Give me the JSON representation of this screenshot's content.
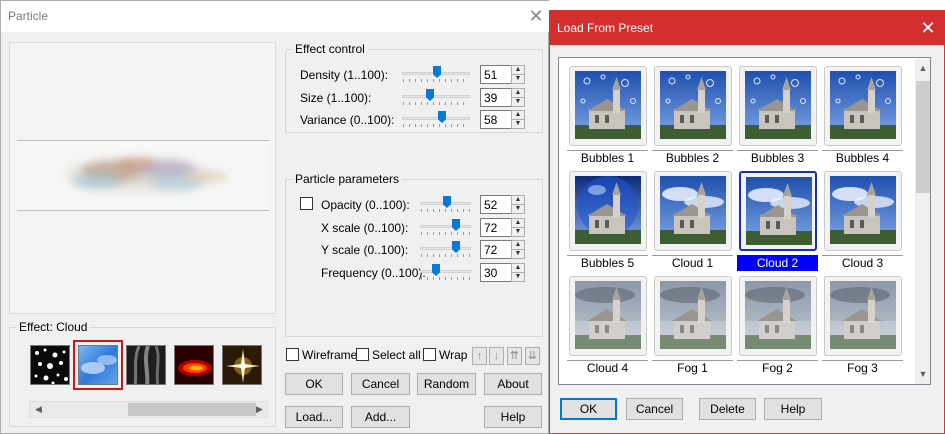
{
  "particle_dialog": {
    "title": "Particle",
    "close_glyph": "✕",
    "effect_group": {
      "label": "Effect: Cloud",
      "thumbnails": [
        {
          "name": "effect-stars",
          "selected": false
        },
        {
          "name": "effect-cloud",
          "selected": true
        },
        {
          "name": "effect-smoke",
          "selected": false
        },
        {
          "name": "effect-fire",
          "selected": false
        },
        {
          "name": "effect-sparkle",
          "selected": false
        }
      ],
      "scroll_left": "◀",
      "scroll_right": "▶"
    },
    "effect_control": {
      "label": "Effect control",
      "density": {
        "label": "Density (1..100):",
        "value": "51"
      },
      "size": {
        "label": "Size (1..100):",
        "value": "39"
      },
      "variance": {
        "label": "Variance (0..100):",
        "value": "58"
      }
    },
    "particle_parameters": {
      "label": "Particle parameters",
      "opacity": {
        "label": "Opacity (0..100):",
        "value": "52",
        "checked": false
      },
      "x_scale": {
        "label": "X scale (0..100):",
        "value": "72"
      },
      "y_scale": {
        "label": "Y scale (0..100):",
        "value": "72"
      },
      "frequency": {
        "label": "Frequency (0..100):",
        "value": "30"
      }
    },
    "options": {
      "wireframe": "Wireframe",
      "select_all": "Select all",
      "wrap": "Wrap"
    },
    "arrow_buttons": [
      "↑",
      "↓",
      "⇈",
      "⇊"
    ],
    "buttons": {
      "ok": "OK",
      "cancel": "Cancel",
      "random": "Random",
      "about": "About",
      "load": "Load...",
      "add": "Add...",
      "help": "Help"
    }
  },
  "preset_dialog": {
    "title": "Load From Preset",
    "close_glyph": "✕",
    "scroll_up": "▲",
    "scroll_down": "▼",
    "presets": [
      {
        "label": "Bubbles 1",
        "style": "bubbles",
        "selected": false
      },
      {
        "label": "Bubbles 2",
        "style": "bubbles",
        "selected": false
      },
      {
        "label": "Bubbles 3",
        "style": "bubbles",
        "selected": false
      },
      {
        "label": "Bubbles 4",
        "style": "bubbles",
        "selected": false
      },
      {
        "label": "Bubbles 5",
        "style": "sphere",
        "selected": false
      },
      {
        "label": "Cloud 1",
        "style": "cloud",
        "selected": false
      },
      {
        "label": "Cloud 2",
        "style": "cloud",
        "selected": true
      },
      {
        "label": "Cloud 3",
        "style": "cloud",
        "selected": false
      },
      {
        "label": "Cloud 4",
        "style": "fog",
        "selected": false
      },
      {
        "label": "Fog 1",
        "style": "fog",
        "selected": false
      },
      {
        "label": "Fog 2",
        "style": "fog",
        "selected": false
      },
      {
        "label": "Fog 3",
        "style": "fog",
        "selected": false
      }
    ],
    "buttons": {
      "ok": "OK",
      "cancel": "Cancel",
      "delete": "Delete",
      "help": "Help"
    }
  },
  "colors": {
    "preset_titlebar": "#d32f2f",
    "selection": "#0000ff",
    "effect_selected_outline": "#c41a1a",
    "slider_thumb": "#0a78d7"
  }
}
